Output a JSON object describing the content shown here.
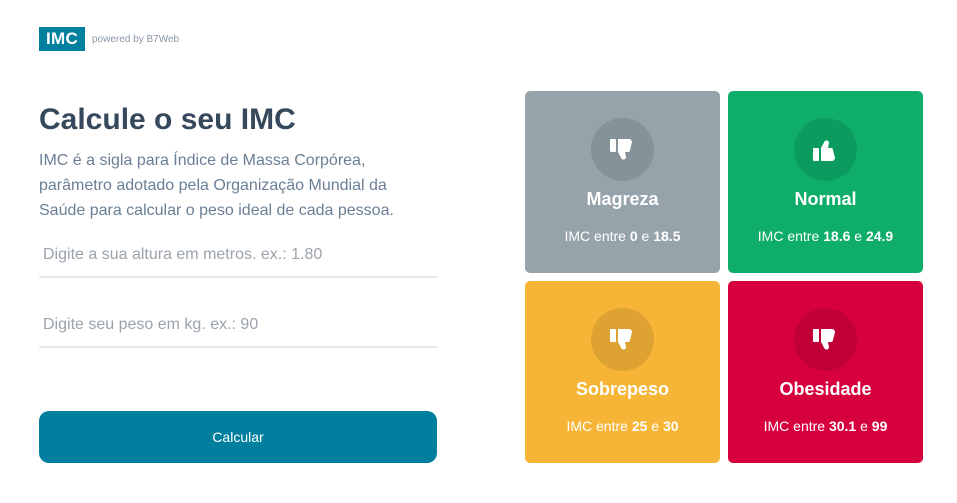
{
  "header": {
    "logo": "IMC",
    "powered": "powered by B7Web"
  },
  "main": {
    "title": "Calcule o seu IMC",
    "description": "IMC é a sigla para Índice de Massa Corpórea, parâmetro adotado pela Organização Mundial da Saúde para calcular o peso ideal de cada pessoa.",
    "height_placeholder": "Digite a sua altura em metros. ex.: 1.80",
    "weight_placeholder": "Digite seu peso em kg. ex.: 90",
    "button_label": "Calcular"
  },
  "cards": [
    {
      "title": "Magreza",
      "prefix": "IMC entre",
      "min": "0",
      "joiner": "e",
      "max": "18.5",
      "icon": "thumbs-down-icon",
      "color": "#96a3ab"
    },
    {
      "title": "Normal",
      "prefix": "IMC entre",
      "min": "18.6",
      "joiner": "e",
      "max": "24.9",
      "icon": "thumbs-up-icon",
      "color": "#0ead69"
    },
    {
      "title": "Sobrepeso",
      "prefix": "IMC entre",
      "min": "25",
      "joiner": "e",
      "max": "30",
      "icon": "thumbs-down-icon",
      "color": "#f7b538"
    },
    {
      "title": "Obesidade",
      "prefix": "IMC entre",
      "min": "30.1",
      "joiner": "e",
      "max": "99",
      "icon": "thumbs-down-icon",
      "color": "#d7003e"
    }
  ]
}
